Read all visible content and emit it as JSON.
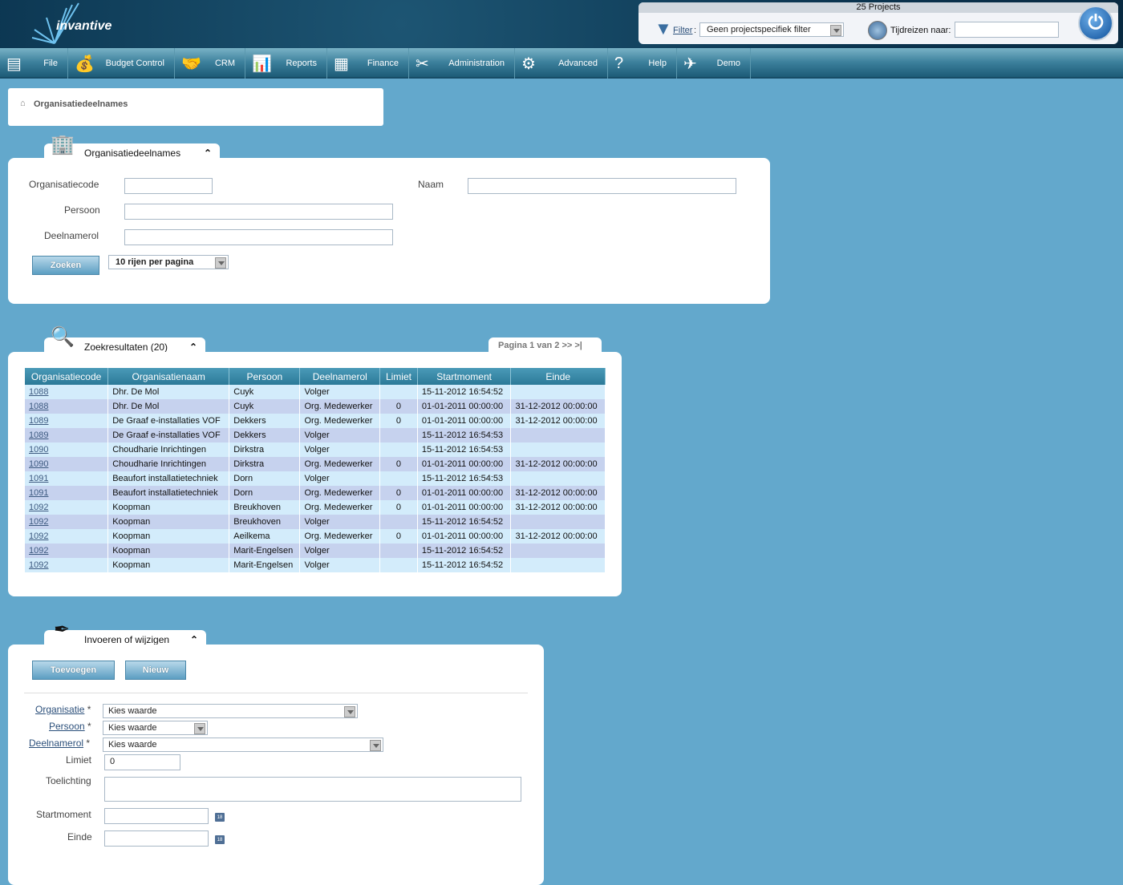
{
  "header": {
    "logo": "invantive",
    "projects_count": "25 Projects",
    "filter_label": "Filter",
    "filter_value": "Geen projectspecifiek filter",
    "timetravel_label": "Tijdreizen naar:",
    "timetravel_value": ""
  },
  "nav": [
    {
      "label": "File",
      "icon": "file-cabinet-icon"
    },
    {
      "label": "Budget Control",
      "icon": "money-bag-icon"
    },
    {
      "label": "CRM",
      "icon": "handshake-icon"
    },
    {
      "label": "Reports",
      "icon": "presentation-chart-icon"
    },
    {
      "label": "Finance",
      "icon": "calculator-icon"
    },
    {
      "label": "Administration",
      "icon": "tools-icon"
    },
    {
      "label": "Advanced",
      "icon": "gears-icon"
    },
    {
      "label": "Help",
      "icon": "help-icon"
    },
    {
      "label": "Demo",
      "icon": "demo-logo-icon"
    }
  ],
  "breadcrumb": "Organisatiedeelnames",
  "search": {
    "tab": "Organisatiedeelnames",
    "fields": {
      "code": "Organisatiecode",
      "naam": "Naam",
      "persoon": "Persoon",
      "rol": "Deelnamerol"
    },
    "button": "Zoeken",
    "rows_per_page": "10 rijen per pagina"
  },
  "results": {
    "tab": "Zoekresultaten (20)",
    "pagination": "Pagina 1 van 2  >>  >|",
    "columns": [
      "Organisatiecode",
      "Organisatienaam",
      "Persoon",
      "Deelnamerol",
      "Limiet",
      "Startmoment",
      "Einde"
    ],
    "rows": [
      [
        "1088",
        "Dhr. De Mol",
        "Cuyk",
        "Volger",
        "",
        "15-11-2012 16:54:52",
        ""
      ],
      [
        "1088",
        "Dhr. De Mol",
        "Cuyk",
        "Org. Medewerker",
        "0",
        "01-01-2011 00:00:00",
        "31-12-2012 00:00:00"
      ],
      [
        "1089",
        "De Graaf e-installaties VOF",
        "Dekkers",
        "Org. Medewerker",
        "0",
        "01-01-2011 00:00:00",
        "31-12-2012 00:00:00"
      ],
      [
        "1089",
        "De Graaf e-installaties VOF",
        "Dekkers",
        "Volger",
        "",
        "15-11-2012 16:54:53",
        ""
      ],
      [
        "1090",
        "Choudharie Inrichtingen",
        "Dirkstra",
        "Volger",
        "",
        "15-11-2012 16:54:53",
        ""
      ],
      [
        "1090",
        "Choudharie Inrichtingen",
        "Dirkstra",
        "Org. Medewerker",
        "0",
        "01-01-2011 00:00:00",
        "31-12-2012 00:00:00"
      ],
      [
        "1091",
        "Beaufort installatietechniek",
        "Dorn",
        "Volger",
        "",
        "15-11-2012 16:54:53",
        ""
      ],
      [
        "1091",
        "Beaufort installatietechniek",
        "Dorn",
        "Org. Medewerker",
        "0",
        "01-01-2011 00:00:00",
        "31-12-2012 00:00:00"
      ],
      [
        "1092",
        "Koopman",
        "Breukhoven",
        "Org. Medewerker",
        "0",
        "01-01-2011 00:00:00",
        "31-12-2012 00:00:00"
      ],
      [
        "1092",
        "Koopman",
        "Breukhoven",
        "Volger",
        "",
        "15-11-2012 16:54:52",
        ""
      ],
      [
        "1092",
        "Koopman",
        "Aeilkema",
        "Org. Medewerker",
        "0",
        "01-01-2011 00:00:00",
        "31-12-2012 00:00:00"
      ],
      [
        "1092",
        "Koopman",
        "Marit-Engelsen",
        "Volger",
        "",
        "15-11-2012 16:54:52",
        ""
      ],
      [
        "1092",
        "Koopman",
        "Marit-Engelsen",
        "Volger",
        "",
        "15-11-2012 16:54:52",
        ""
      ]
    ]
  },
  "edit": {
    "tab": "Invoeren of wijzigen",
    "add": "Toevoegen",
    "new": "Nieuw",
    "organisatie": "Organisatie",
    "persoon": "Persoon",
    "rol": "Deelnamerol",
    "required": "*",
    "placeholder": "Kies waarde",
    "limiet": "Limiet",
    "limiet_value": "0",
    "toelichting": "Toelichting",
    "startmoment": "Startmoment",
    "einde": "Einde"
  }
}
